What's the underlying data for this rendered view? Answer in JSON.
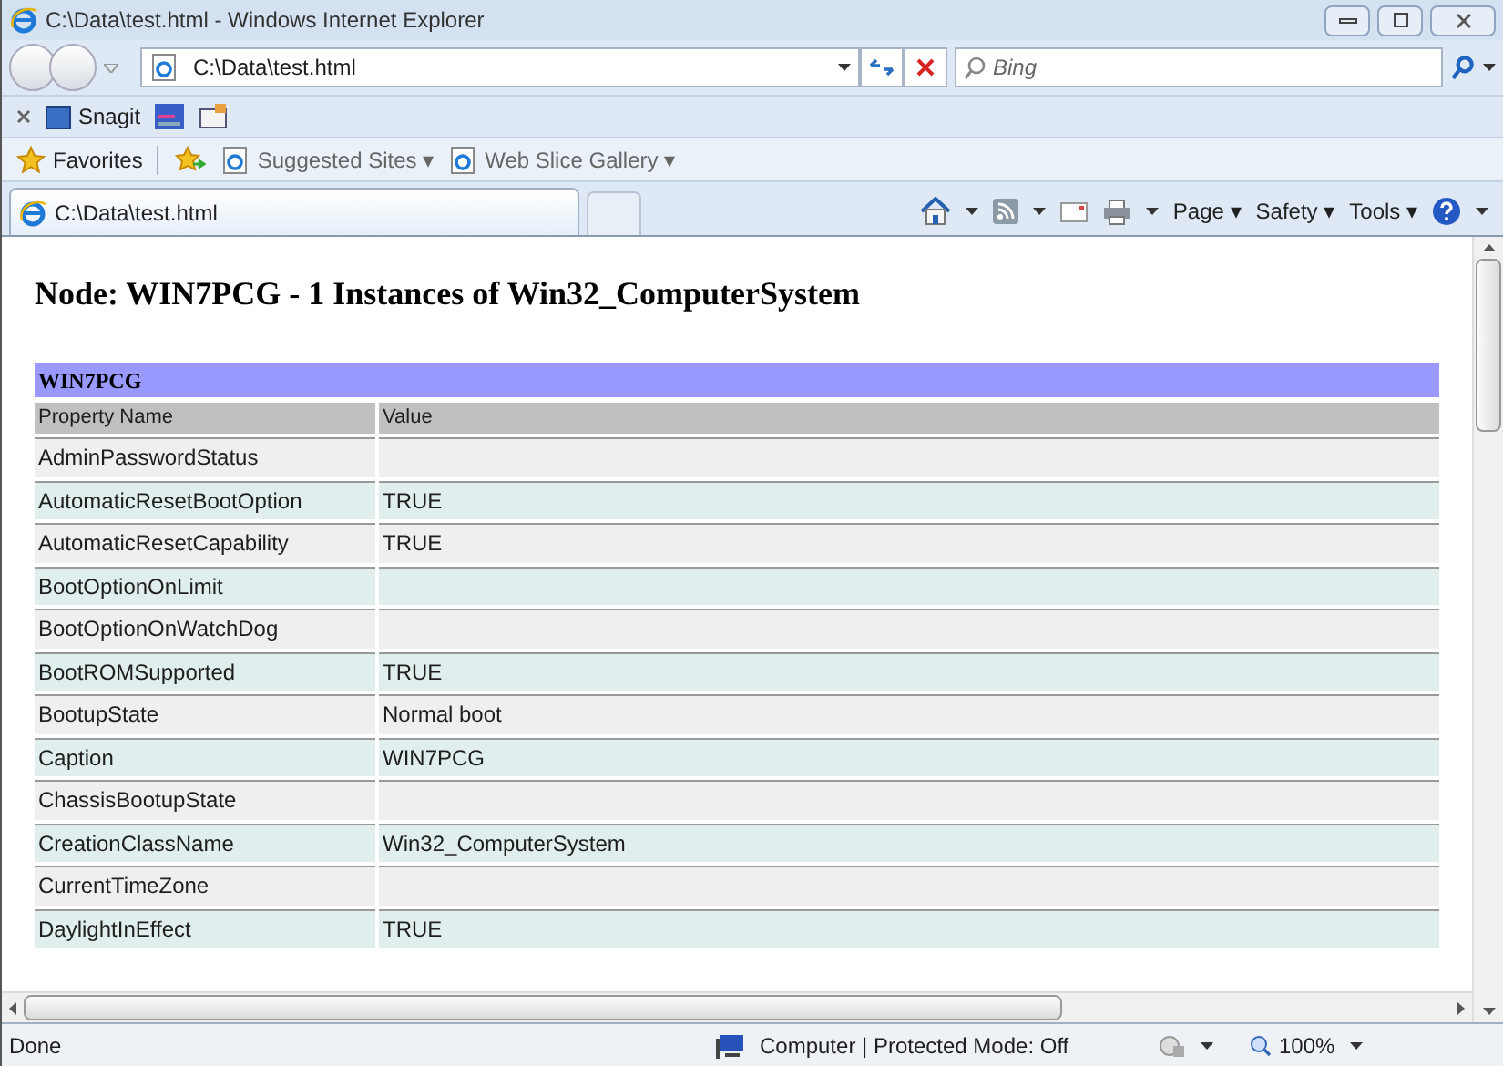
{
  "window": {
    "title": "C:\\Data\\test.html - Windows Internet Explorer"
  },
  "address_bar": {
    "value": "C:\\Data\\test.html"
  },
  "search": {
    "placeholder": "Bing"
  },
  "toolbar": {
    "items": [
      "Snagit"
    ]
  },
  "favorites_bar": {
    "items": [
      "Favorites",
      "Suggested Sites ▾",
      "Web Slice Gallery ▾"
    ]
  },
  "tabs": [
    {
      "label": "C:\\Data\\test.html",
      "selected": true
    }
  ],
  "command_bar": [
    "Page ▾",
    "Safety ▾",
    "Tools ▾"
  ],
  "page": {
    "heading": "Node: WIN7PCG - 1 Instances of Win32_ComputerSystem",
    "table": {
      "caption": "WIN7PCG",
      "columns": [
        "Property Name",
        "Value"
      ],
      "rows": [
        {
          "name": "AdminPasswordStatus",
          "value": ""
        },
        {
          "name": "AutomaticResetBootOption",
          "value": "TRUE"
        },
        {
          "name": "AutomaticResetCapability",
          "value": "TRUE"
        },
        {
          "name": "BootOptionOnLimit",
          "value": ""
        },
        {
          "name": "BootOptionOnWatchDog",
          "value": ""
        },
        {
          "name": "BootROMSupported",
          "value": "TRUE"
        },
        {
          "name": "BootupState",
          "value": "Normal boot"
        },
        {
          "name": "Caption",
          "value": "WIN7PCG"
        },
        {
          "name": "ChassisBootupState",
          "value": ""
        },
        {
          "name": "CreationClassName",
          "value": "Win32_ComputerSystem"
        },
        {
          "name": "CurrentTimeZone",
          "value": ""
        },
        {
          "name": "DaylightInEffect",
          "value": "TRUE"
        }
      ]
    }
  },
  "status_bar": {
    "status": "Done",
    "zone": "Computer | Protected Mode: Off",
    "zoom": "100%"
  }
}
